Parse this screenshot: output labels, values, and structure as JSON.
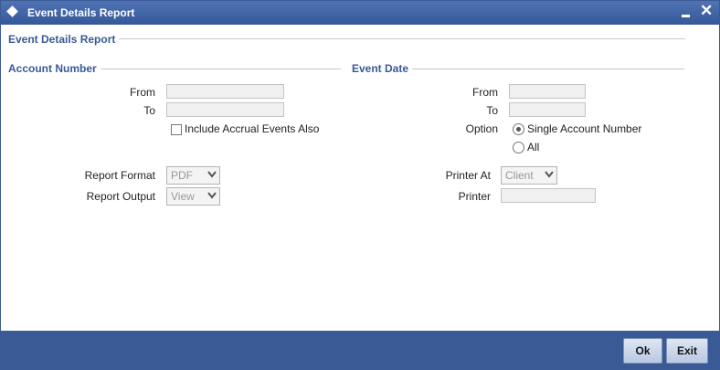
{
  "window": {
    "title": "Event Details Report",
    "minimize_icon": "minimize-icon",
    "close_icon": "close-icon"
  },
  "section": {
    "title": "Event Details Report"
  },
  "account": {
    "title": "Account Number",
    "from_label": "From",
    "to_label": "To",
    "from_value": "",
    "to_value": "",
    "include_accrual_label": "Include Accrual Events Also",
    "include_accrual_checked": false
  },
  "event_date": {
    "title": "Event Date",
    "from_label": "From",
    "to_label": "To",
    "from_value": "",
    "to_value": "",
    "option_label": "Option",
    "options": [
      {
        "label": "Single Account Number",
        "selected": true
      },
      {
        "label": "All",
        "selected": false
      }
    ]
  },
  "report": {
    "format_label": "Report Format",
    "format_value": "PDF",
    "output_label": "Report Output",
    "output_value": "View"
  },
  "printer": {
    "printer_at_label": "Printer At",
    "printer_at_value": "Client",
    "printer_label": "Printer",
    "printer_value": ""
  },
  "buttons": {
    "ok": "Ok",
    "exit": "Exit"
  }
}
